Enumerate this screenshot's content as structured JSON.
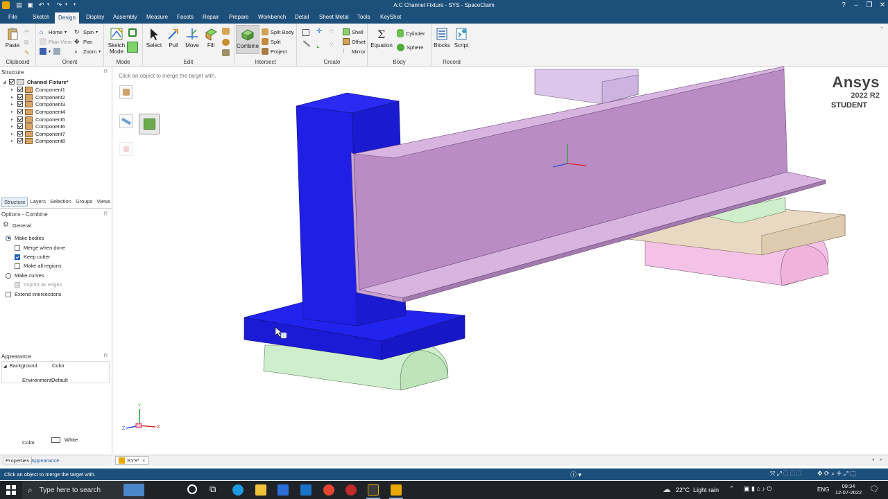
{
  "app": {
    "title": "A:C Channel Fixture - SYS - SpaceClaim"
  },
  "menu": [
    "File",
    "Sketch",
    "Design",
    "Display",
    "Assembly",
    "Measure",
    "Facets",
    "Repair",
    "Prepare",
    "Workbench",
    "Detail",
    "Sheet Metal",
    "Tools",
    "KeyShot"
  ],
  "ribbon": {
    "clipboard": {
      "label": "Clipboard",
      "paste": "Paste"
    },
    "orient": {
      "label": "Orient",
      "home": "Home",
      "plan_view": "Plan View",
      "spin": "Spin",
      "pan": "Pan",
      "zoom": "Zoom"
    },
    "mode": {
      "label": "Mode",
      "sketch_mode": "Sketch Mode"
    },
    "edit": {
      "label": "Edit",
      "select": "Select",
      "pull": "Pull",
      "move": "Move",
      "fill": "Fill"
    },
    "intersect": {
      "label": "Intersect",
      "combine": "Combine",
      "split_body": "Split Body",
      "split": "Split",
      "project": "Project"
    },
    "create": {
      "label": "Create",
      "shell": "Shell",
      "offset": "Offset",
      "mirror": "Mirror"
    },
    "body": {
      "label": "Body",
      "equation": "Equation",
      "cylinder": "Cylinder",
      "sphere": "Sphere"
    },
    "record": {
      "label": "Record",
      "blocks": "Blocks",
      "script": "Script"
    }
  },
  "structure": {
    "title": "Structure",
    "root": "Channel Fixture*",
    "components": [
      "Component1",
      "Component2",
      "Component3",
      "Component4",
      "Component5",
      "Component6",
      "Component7",
      "Component8"
    ]
  },
  "panel_tabs": [
    "Structure",
    "Layers",
    "Selection",
    "Groups",
    "Views"
  ],
  "options": {
    "title": "Options - Combine",
    "section": "General",
    "make_bodies": "Make bodies",
    "merge_when_done": "Merge when done",
    "keep_cutter": "Keep cutter",
    "make_all_regions": "Make all regions",
    "make_curves": "Make curves",
    "imprint_as_edges": "Imprint as edges",
    "extend_intersections": "Extend intersections"
  },
  "appearance": {
    "title": "Appearance",
    "background_label": "Background",
    "background_value": "Color",
    "color_label": "Color",
    "color_value": "White",
    "environment_label": "Environment",
    "environment_value": "Default"
  },
  "bottom_tabs": {
    "properties": "Properties",
    "appearance": "Appearance"
  },
  "viewport": {
    "hint": "Click an object to merge the target with.",
    "logo_brand": "Ansys",
    "logo_version": "2022 R2",
    "logo_edition": "STUDENT",
    "triad": {
      "x": "X",
      "y": "Y",
      "z": "Z"
    }
  },
  "document_tab": "SYS*",
  "status": "Click an object to merge the target with.",
  "taskbar": {
    "search_placeholder": "Type here to search",
    "weather": "22°C  Light rain",
    "language": "ENG",
    "time": "09:34",
    "date": "12-07-2022"
  },
  "colors": {
    "titlebar": "#1c4f7a",
    "blue_part": "#1f1fe6",
    "channel": "#c99bd4",
    "green_support": "#cfeecb",
    "pink_support": "#f4c2e6",
    "tan_plate": "#ead9c2"
  }
}
